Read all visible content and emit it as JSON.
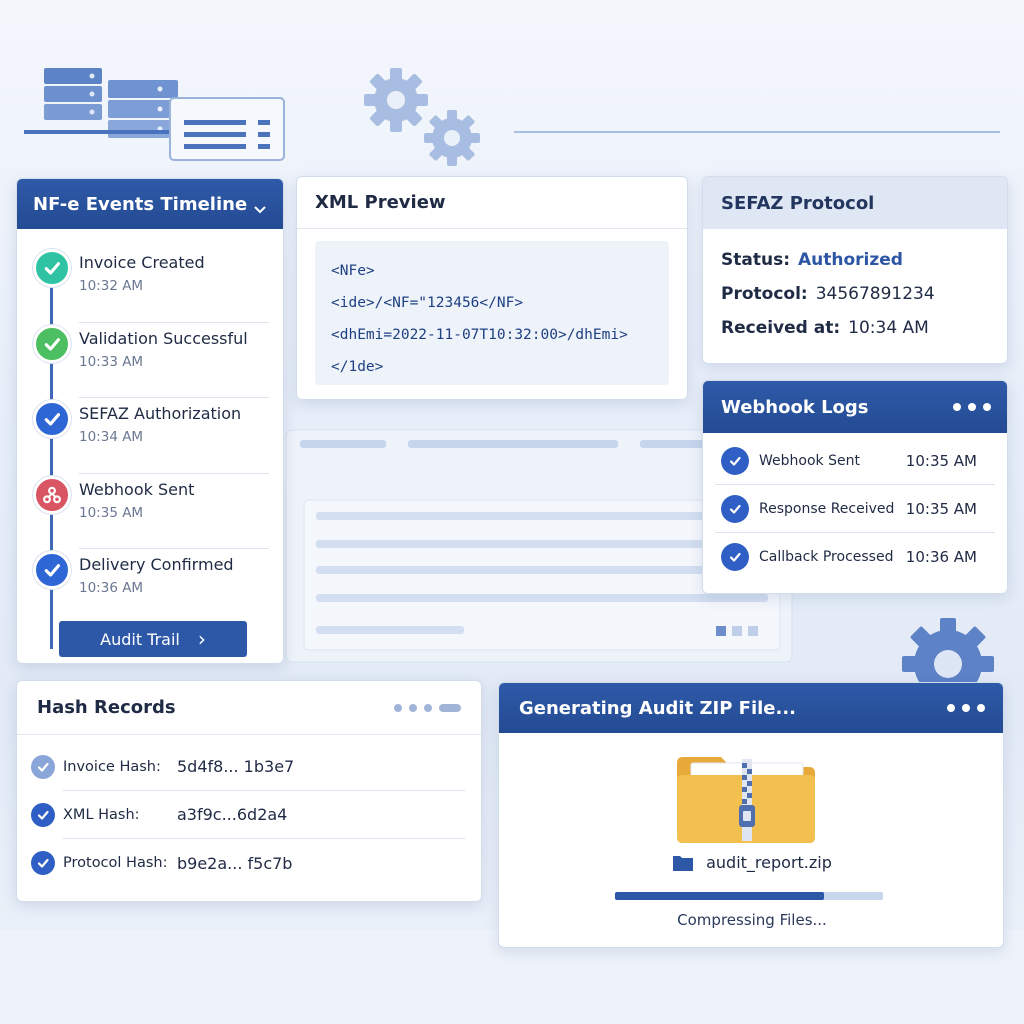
{
  "colors": {
    "accent_blue": "#2c55a3",
    "teal_check": "#2fc3a4",
    "green_check": "#4cbf62",
    "blue_check": "#2f66d6",
    "red_node": "#d95563",
    "folder_yellow": "#f2c04e"
  },
  "timeline": {
    "title": "NF-e Events Timeline",
    "items": [
      {
        "label": "Invoice Created",
        "time": "10:32 AM",
        "icon": "check-icon",
        "color": "#2fc3a4"
      },
      {
        "label": "Validation Successful",
        "time": "10:33 AM",
        "icon": "check-icon",
        "color": "#4cbf62"
      },
      {
        "label": "SEFAZ Authorization",
        "time": "10:34 AM",
        "icon": "check-icon",
        "color": "#2f66d6"
      },
      {
        "label": "Webhook Sent",
        "time": "10:35 AM",
        "icon": "webhook-icon",
        "color": "#d95563"
      },
      {
        "label": "Delivery Confirmed",
        "time": "10:36 AM",
        "icon": "check-icon",
        "color": "#2f66d6"
      }
    ],
    "audit_button": "Audit Trail",
    "audit_chevron": "›"
  },
  "xml": {
    "title": "XML Preview",
    "lines": [
      "<NFe>",
      "<ide>/<NF=\"123456</NF>",
      "<dhEmi=2022-11-07T10:32:00>/dhEmi>",
      "</1de>"
    ]
  },
  "sefaz": {
    "title": "SEFAZ Protocol",
    "status_label": "Status:",
    "status_value": "Authorized",
    "protocol_label": "Protocol:",
    "protocol_value": "34567891234",
    "received_label": "Received at:",
    "received_value": "10:34 AM"
  },
  "webhook": {
    "title": "Webhook Logs",
    "rows": [
      {
        "label": "Webhook Sent",
        "time": "10:35 AM"
      },
      {
        "label": "Response Received",
        "time": "10:35 AM"
      },
      {
        "label": "Callback Processed",
        "time": "10:36 AM"
      }
    ]
  },
  "hash": {
    "title": "Hash Records",
    "rows": [
      {
        "label": "Invoice Hash:",
        "value": "5d4f8... 1b3e7"
      },
      {
        "label": "XML Hash:",
        "value": "a3f9c...6d2a4"
      },
      {
        "label": "Protocol Hash:",
        "value": "b9e2a... f5c7b"
      }
    ]
  },
  "zip": {
    "title": "Generating Audit ZIP File...",
    "filename": "audit_report.zip",
    "progress": 0.78,
    "status": "Compressing Files..."
  }
}
